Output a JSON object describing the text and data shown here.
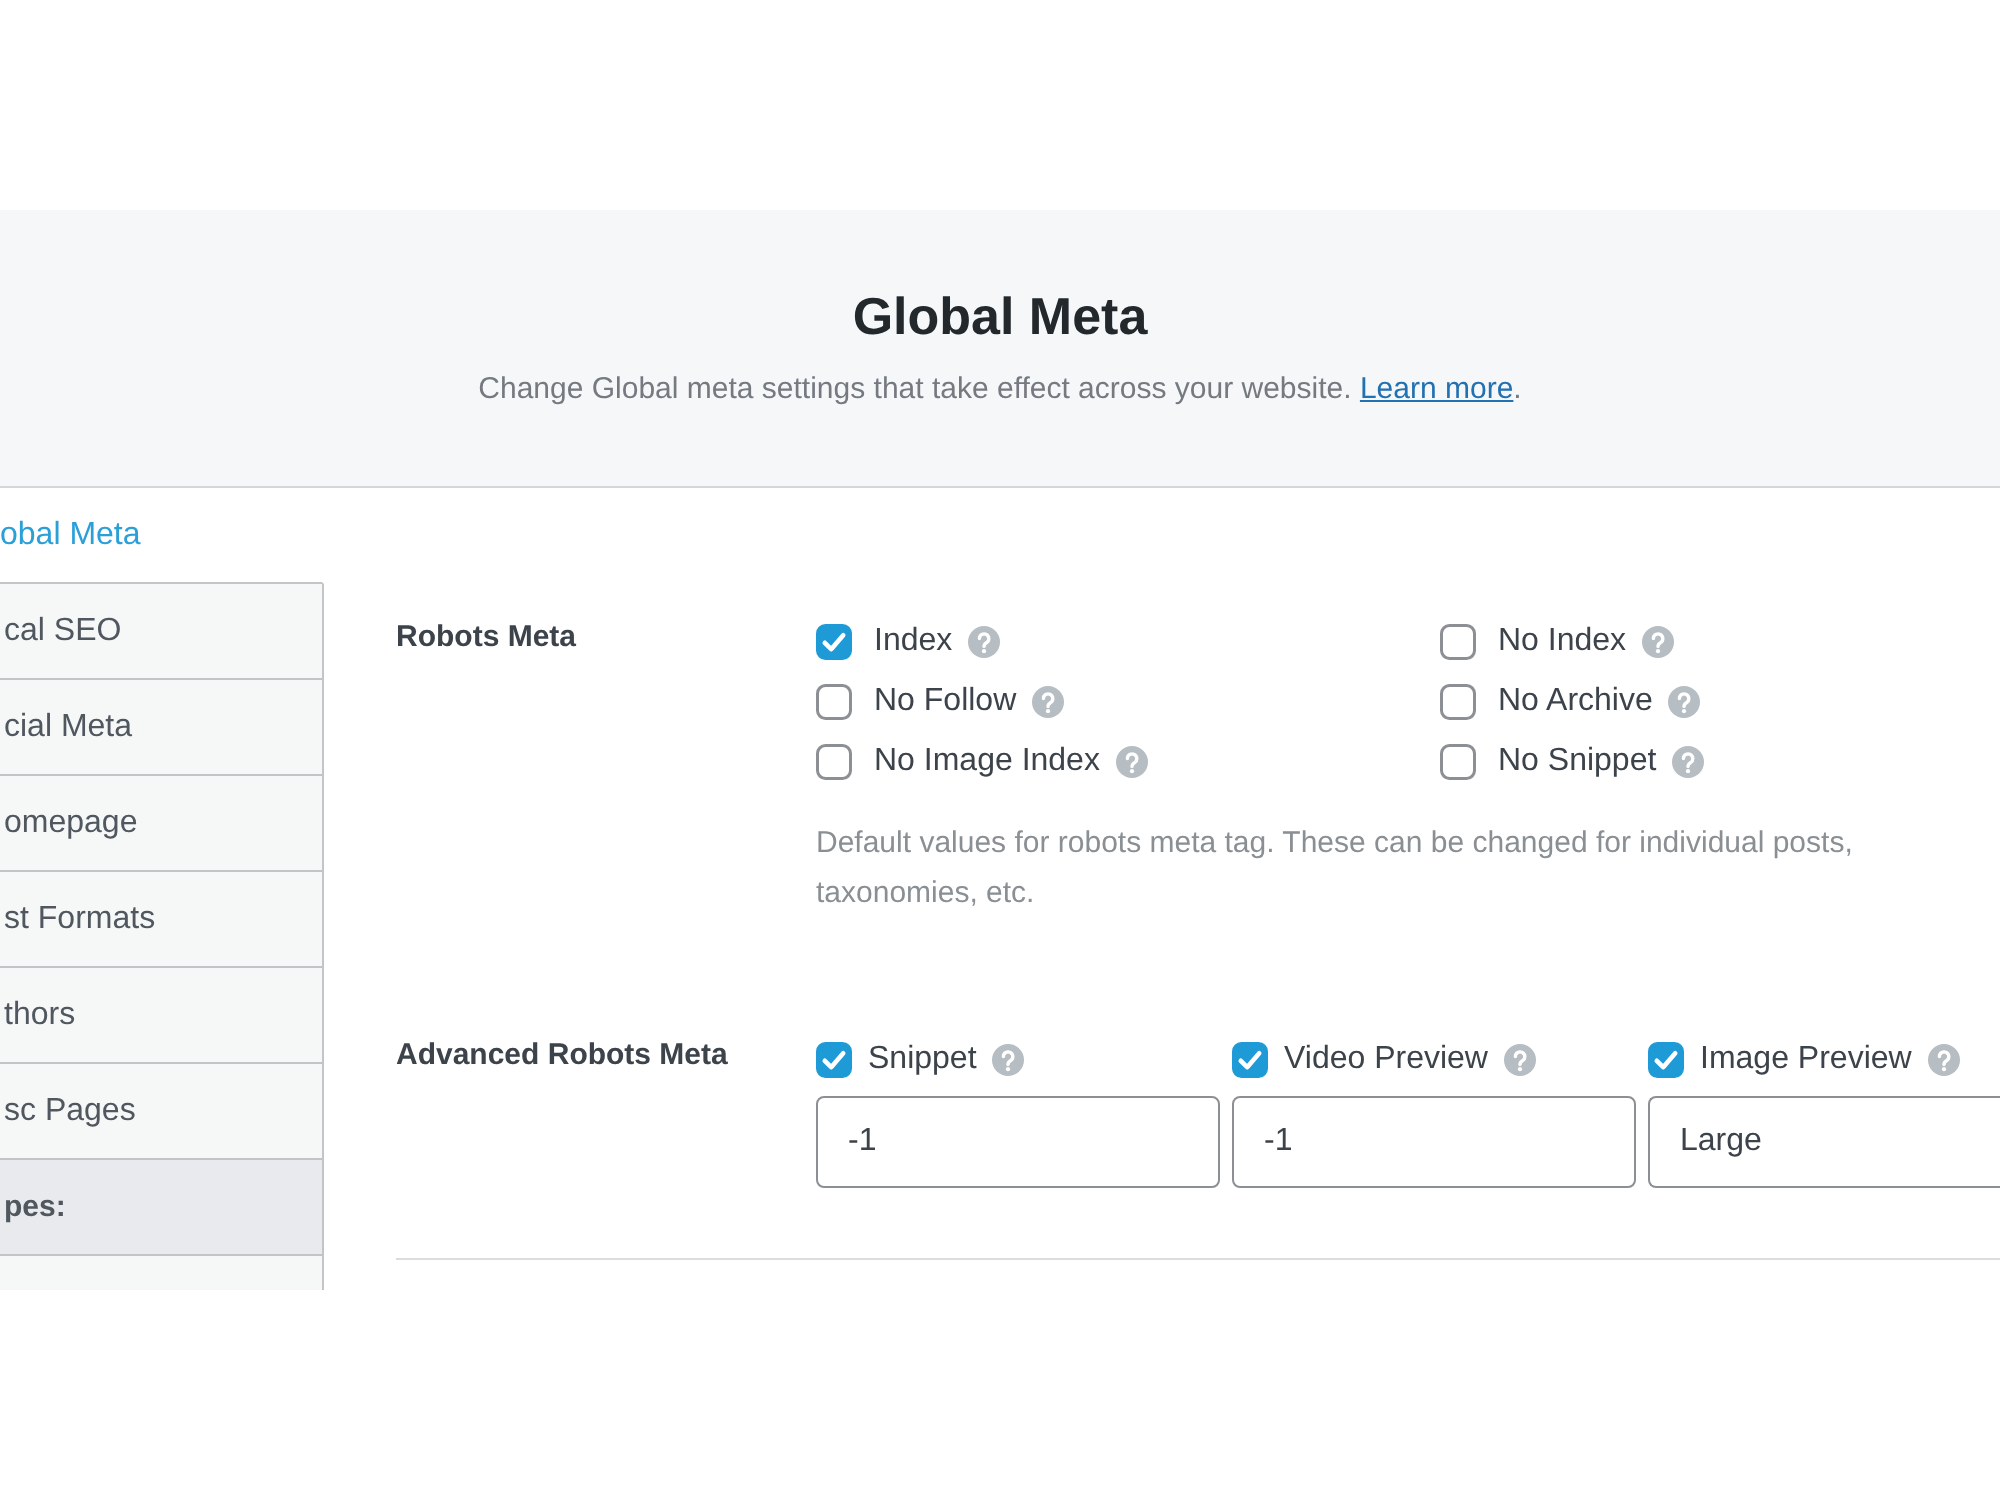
{
  "header": {
    "title": "Global Meta",
    "description": "Change Global meta settings that take effect across your website.",
    "link": "Learn more",
    "description_end": "."
  },
  "sidebar": {
    "items": [
      {
        "kind": "link",
        "label": "obal Meta",
        "selected": true
      },
      {
        "kind": "link",
        "label": "cal SEO",
        "selected": false
      },
      {
        "kind": "link",
        "label": "cial Meta",
        "selected": false
      },
      {
        "kind": "link",
        "label": "omepage",
        "selected": false
      },
      {
        "kind": "link",
        "label": "st Formats",
        "selected": false
      },
      {
        "kind": "link",
        "label": "thors",
        "selected": false
      },
      {
        "kind": "link",
        "label": "sc Pages",
        "selected": false
      },
      {
        "kind": "heading",
        "label": "pes:",
        "selected": false
      }
    ]
  },
  "robots_meta": {
    "label": "Robots Meta",
    "options": [
      {
        "label": "Index",
        "checked": true
      },
      {
        "label": "No Index",
        "checked": false
      },
      {
        "label": "No Follow",
        "checked": false
      },
      {
        "label": "No Archive",
        "checked": false
      },
      {
        "label": "No Image Index",
        "checked": false
      },
      {
        "label": "No Snippet",
        "checked": false
      }
    ],
    "description": "Default values for robots meta tag. These can be changed for individual posts, taxonomies, etc."
  },
  "advanced_robots_meta": {
    "label": "Advanced Robots Meta",
    "options": [
      {
        "label": "Snippet",
        "checked": true,
        "value": "-1"
      },
      {
        "label": "Video Preview",
        "checked": true,
        "value": "-1"
      },
      {
        "label": "Image Preview",
        "checked": true,
        "value": "Large"
      }
    ]
  }
}
